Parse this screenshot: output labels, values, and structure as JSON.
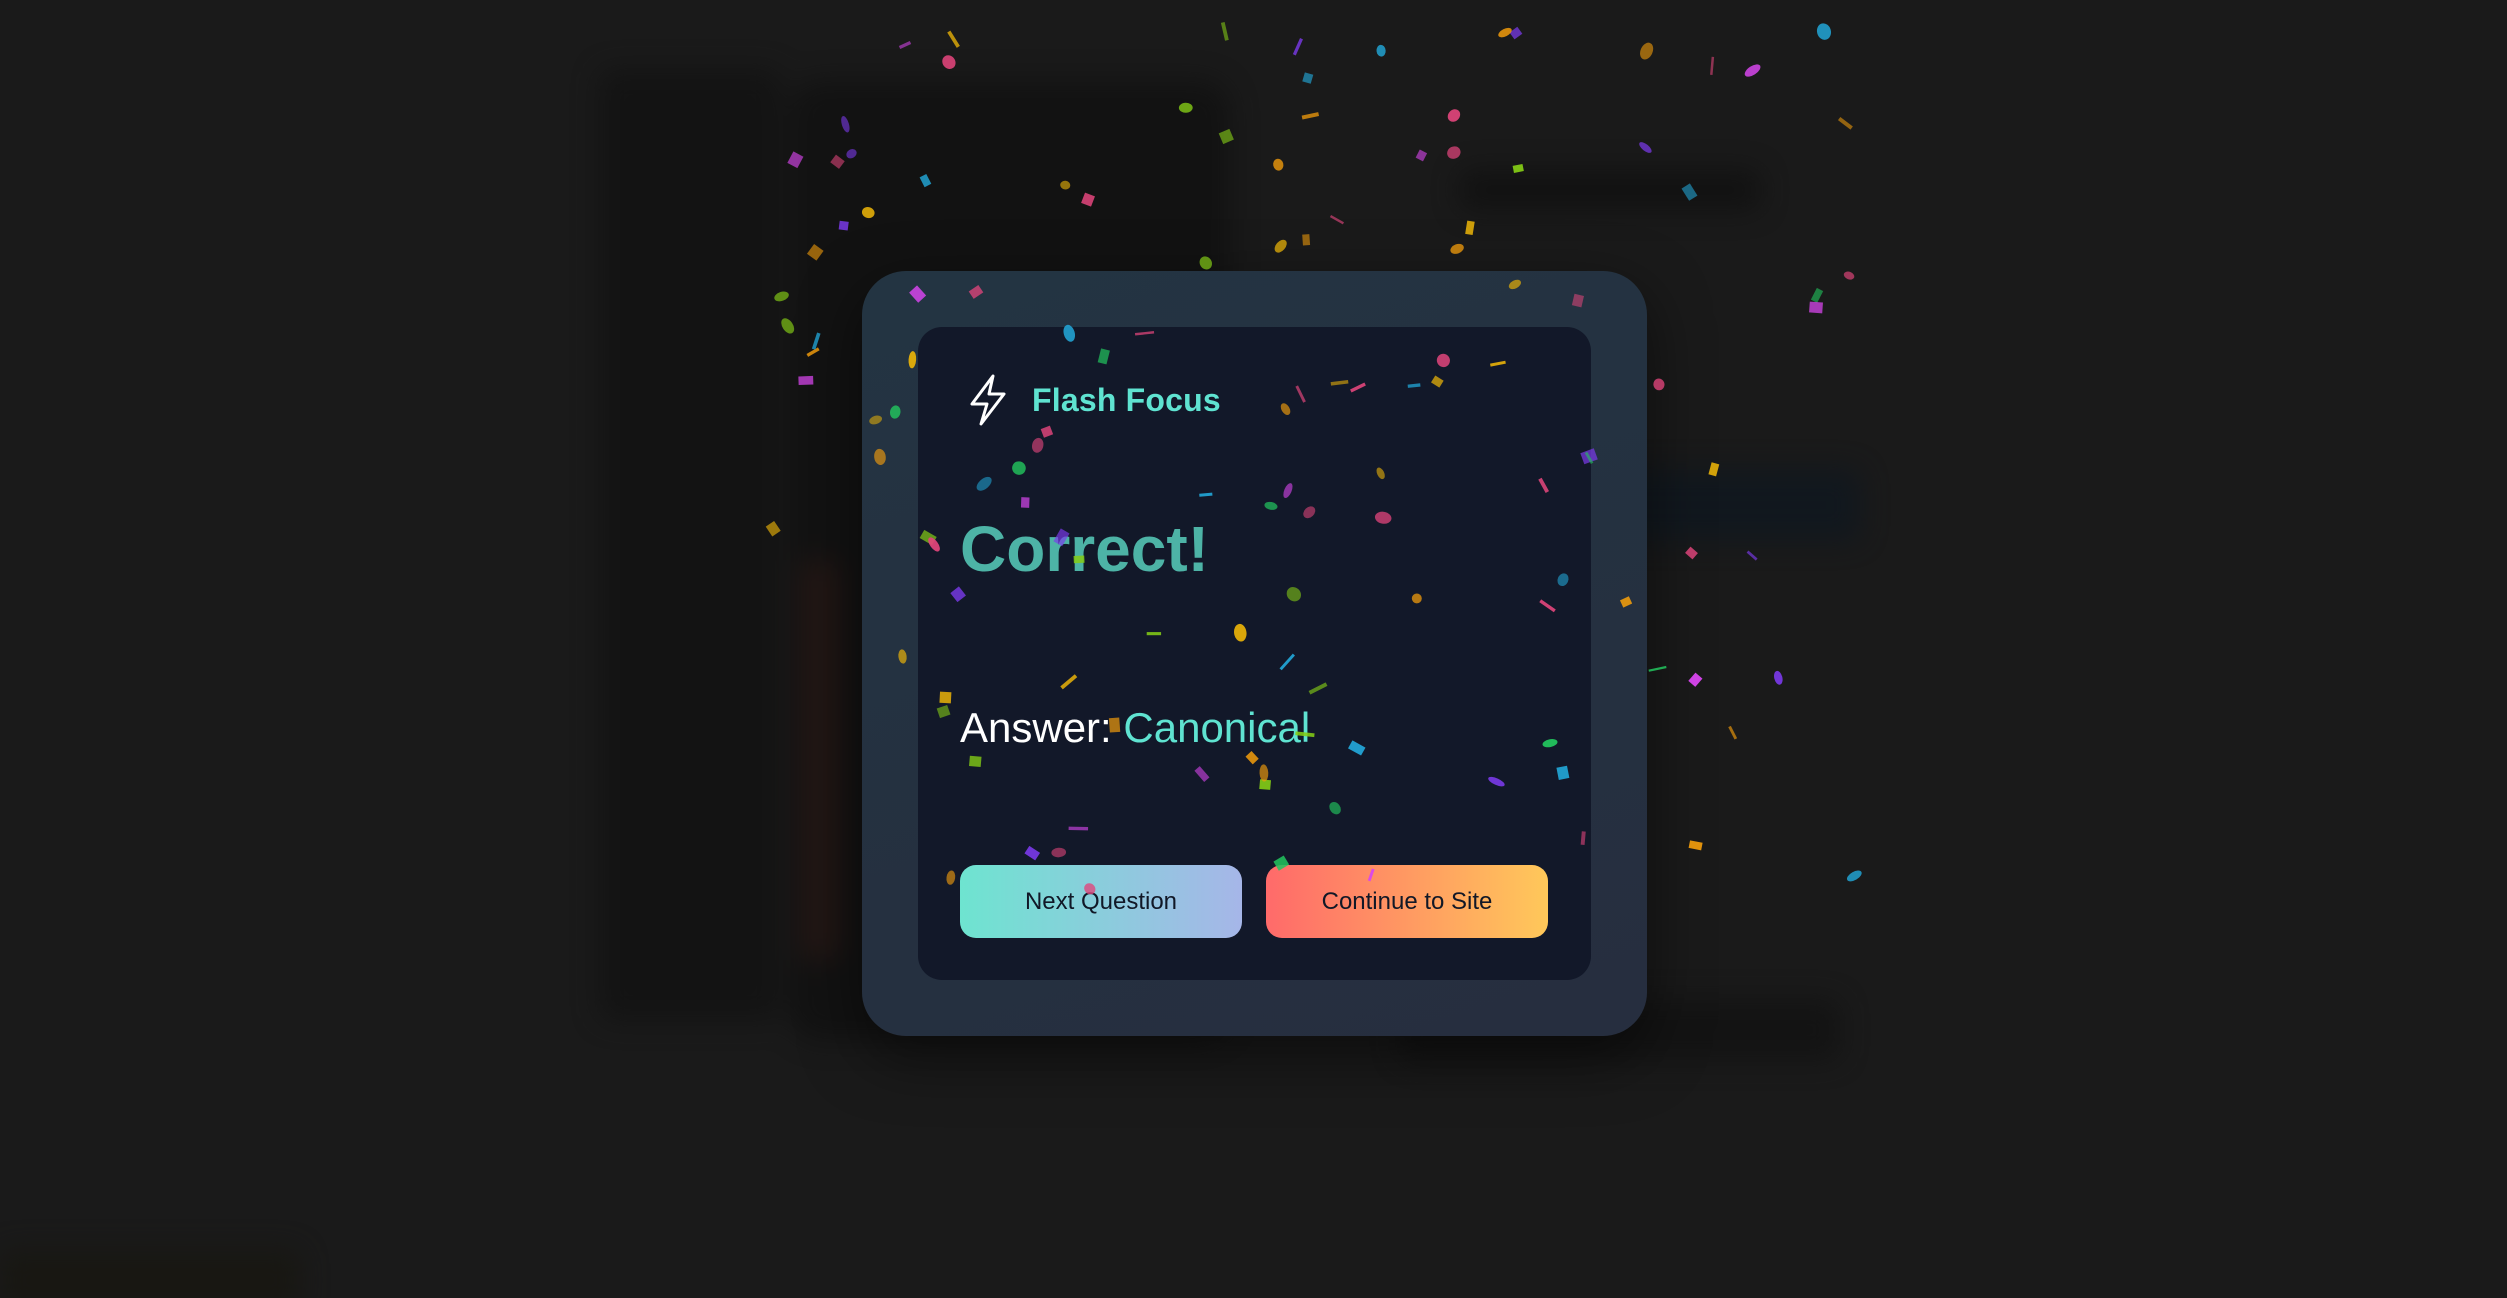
{
  "app": {
    "name": "Flash Focus",
    "icon": "lightning-bolt-icon"
  },
  "result": {
    "title": "Correct!",
    "answer_label": "Answer:",
    "answer_value": "Canonical"
  },
  "actions": {
    "next_label": "Next Question",
    "continue_label": "Continue to Site"
  },
  "colors": {
    "accent": "#5fe3d1",
    "title": "#4db3a6",
    "card_bg": "#121829",
    "frame_bg": "#233442",
    "next_gradient": [
      "#6ee4d0",
      "#a6b6e8"
    ],
    "continue_gradient": [
      "#ff6a6a",
      "#ffc85a"
    ],
    "confetti": [
      "#e0457b",
      "#7c3aed",
      "#22a7d8",
      "#f59e0b",
      "#84cc16",
      "#d946ef",
      "#eab308",
      "#22c55e"
    ]
  }
}
